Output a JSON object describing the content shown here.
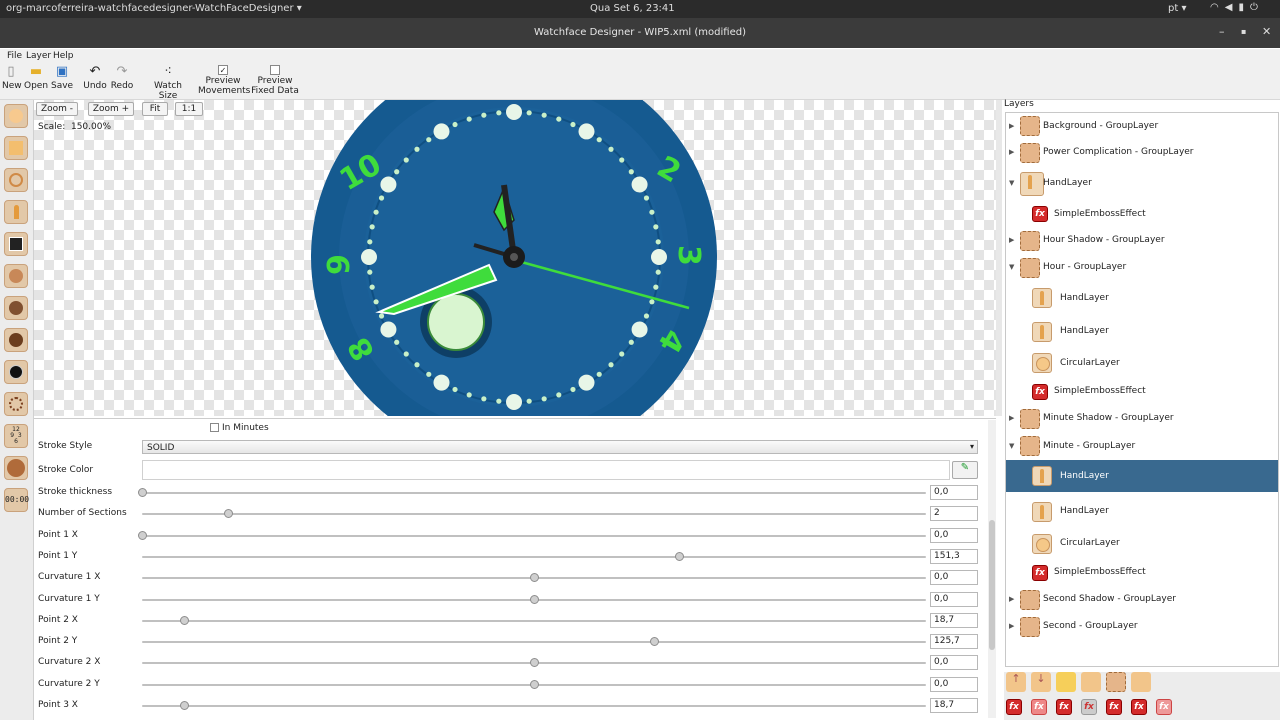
{
  "system_bar": {
    "app_name": "org-marcoferreira-watchfacedesigner-WatchFaceDesigner ▾",
    "clock": "Qua Set  6, 23:41",
    "language": "pt ▾",
    "icons": [
      "wifi-icon",
      "volume-icon",
      "battery-icon",
      "power-icon"
    ]
  },
  "window": {
    "title": "Watchface Designer - WIP5.xml (modified)",
    "minimize": "–",
    "maximize": "▪",
    "close": "✕"
  },
  "menu": {
    "file": "File",
    "layer": "Layer",
    "help": "Help"
  },
  "toolbar": {
    "new": "New",
    "open": "Open",
    "save": "Save",
    "undo": "Undo",
    "redo": "Redo",
    "watch_size": "Watch Size",
    "preview_movements_1": "Preview",
    "preview_movements_2": "Movements",
    "preview_movements_checked": true,
    "preview_fixed_1": "Preview",
    "preview_fixed_2": "Fixed Data",
    "preview_fixed_checked": false
  },
  "canvas": {
    "zoom_out": "Zoom -",
    "zoom_in": "Zoom +",
    "fit": "Fit",
    "one_to_one": "1:1",
    "scale_label": "Scale:",
    "scale_value": "150.00%",
    "dial_numbers": [
      "10",
      "2",
      "3",
      "4",
      "8",
      "9"
    ],
    "colors": {
      "dial": "#1a5e96",
      "accent": "#3fdc3c"
    }
  },
  "properties": {
    "in_minutes_label": "In Minutes",
    "in_minutes_checked": false,
    "stroke_style_label": "Stroke Style",
    "stroke_style_value": "SOLID",
    "stroke_color_label": "Stroke Color",
    "sliders": [
      {
        "label": "Stroke thickness",
        "value": "0,0",
        "pos": 0.0
      },
      {
        "label": "Number of Sections",
        "value": "2",
        "pos": 0.11
      },
      {
        "label": "Point 1 X",
        "value": "0,0",
        "pos": 0.0
      },
      {
        "label": "Point 1 Y",
        "value": "151,3",
        "pos": 0.685
      },
      {
        "label": "Curvature 1 X",
        "value": "0,0",
        "pos": 0.5
      },
      {
        "label": "Curvature 1 Y",
        "value": "0,0",
        "pos": 0.5
      },
      {
        "label": "Point 2 X",
        "value": "18,7",
        "pos": 0.053
      },
      {
        "label": "Point 2 Y",
        "value": "125,7",
        "pos": 0.653
      },
      {
        "label": "Curvature 2 X",
        "value": "0,0",
        "pos": 0.5
      },
      {
        "label": "Curvature 2 Y",
        "value": "0,0",
        "pos": 0.5
      },
      {
        "label": "Point 3 X",
        "value": "18,7",
        "pos": 0.053
      }
    ]
  },
  "layers": {
    "header": "Layers",
    "items": [
      {
        "label": "Background - GroupLayer",
        "type": "group",
        "expanded": false,
        "indent": 0
      },
      {
        "label": "Power Complication - GroupLayer",
        "type": "group",
        "expanded": false,
        "indent": 0
      },
      {
        "label": "HandLayer",
        "type": "hand",
        "expanded": true,
        "indent": 0
      },
      {
        "label": "SimpleEmbossEffect",
        "type": "fx",
        "indent": 1
      },
      {
        "label": "Hour Shadow - GroupLayer",
        "type": "group",
        "expanded": false,
        "indent": 0
      },
      {
        "label": "Hour - GroupLayer",
        "type": "group",
        "expanded": true,
        "indent": 0
      },
      {
        "label": "HandLayer",
        "type": "hand",
        "indent": 1
      },
      {
        "label": "HandLayer",
        "type": "hand",
        "indent": 1
      },
      {
        "label": "CircularLayer",
        "type": "circle",
        "indent": 1
      },
      {
        "label": "SimpleEmbossEffect",
        "type": "fx",
        "indent": 1
      },
      {
        "label": "Minute Shadow - GroupLayer",
        "type": "group",
        "expanded": false,
        "indent": 0
      },
      {
        "label": "Minute - GroupLayer",
        "type": "group",
        "expanded": true,
        "indent": 0
      },
      {
        "label": "HandLayer",
        "type": "hand",
        "indent": 1,
        "selected": true
      },
      {
        "label": "HandLayer",
        "type": "hand",
        "indent": 1
      },
      {
        "label": "CircularLayer",
        "type": "circle",
        "indent": 1
      },
      {
        "label": "SimpleEmbossEffect",
        "type": "fx",
        "indent": 1
      },
      {
        "label": "Second Shadow - GroupLayer",
        "type": "group",
        "expanded": false,
        "indent": 0
      },
      {
        "label": "Second - GroupLayer",
        "type": "group",
        "expanded": false,
        "indent": 0
      }
    ]
  },
  "left_tools": [
    "circle-tool-icon",
    "rect-tool-icon",
    "ring-tool-icon",
    "hand-tool-icon",
    "image-tool-icon",
    "texture-tool-icon",
    "dots-tool-icon",
    "dark-texture-tool-icon",
    "black-circle-tool-icon",
    "dashed-ring-tool-icon",
    "numbers-tool-icon",
    "knob-tool-icon",
    "digital-tool-icon"
  ],
  "left_tools_text": {
    "numbers": "12\n9 3\n6",
    "digital": "00:00"
  }
}
